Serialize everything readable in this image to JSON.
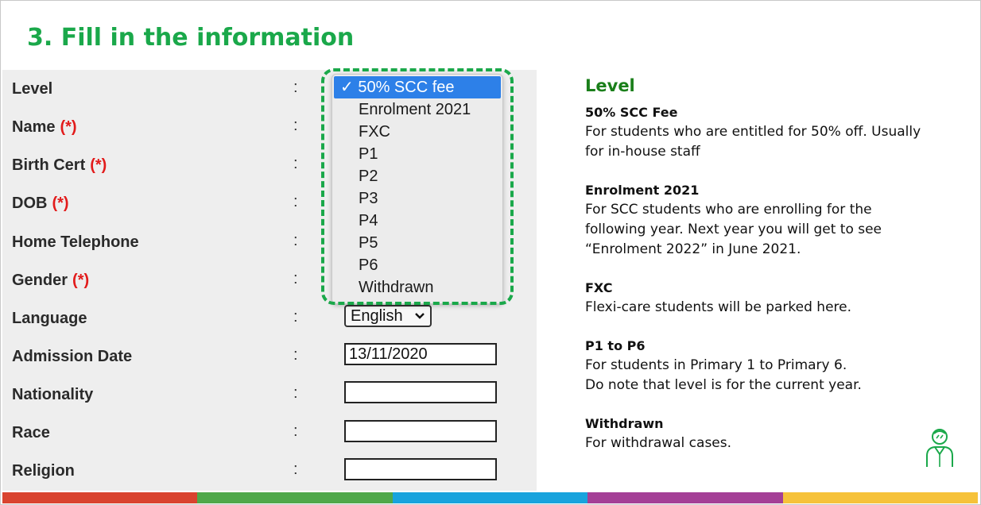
{
  "slide": {
    "title": "3. Fill in the information"
  },
  "form": {
    "colon": ":",
    "required_mark": "(*)",
    "fields": [
      {
        "label": "Level",
        "required": false
      },
      {
        "label": "Name",
        "required": true
      },
      {
        "label": "Birth Cert",
        "required": true
      },
      {
        "label": "DOB",
        "required": true
      },
      {
        "label": "Home Telephone",
        "required": false
      },
      {
        "label": "Gender",
        "required": true
      },
      {
        "label": "Language",
        "required": false
      },
      {
        "label": "Admission Date",
        "required": false
      },
      {
        "label": "Nationality",
        "required": false
      },
      {
        "label": "Race",
        "required": false
      },
      {
        "label": "Religion",
        "required": false
      }
    ],
    "language_value": "English",
    "admission_date_value": "13/11/2020",
    "nationality_value": "",
    "race_value": "",
    "religion_value": ""
  },
  "level_dropdown": {
    "checkmark": "✓",
    "selected": "50% SCC fee",
    "options": [
      "50% SCC fee",
      "Enrolment 2021",
      "FXC",
      "P1",
      "P2",
      "P3",
      "P4",
      "P5",
      "P6",
      "Withdrawn"
    ]
  },
  "notes": {
    "title": "Level",
    "items": [
      {
        "head": "50% SCC Fee",
        "lines": [
          "For students who are entitled for 50% off. Usually",
          "for in-house staff"
        ]
      },
      {
        "head": "Enrolment 2021",
        "lines": [
          "For SCC students who are enrolling for the",
          "following year. Next year you will get to see",
          "“Enrolment 2022” in June 2021."
        ]
      },
      {
        "head": "FXC",
        "lines": [
          "Flexi-care students will be parked here."
        ]
      },
      {
        "head": "P1 to P6",
        "lines": [
          "For students in Primary 1 to Primary 6.",
          "Do note that level is for the current year."
        ]
      },
      {
        "head": "Withdrawn",
        "lines": [
          "For withdrawal cases."
        ]
      }
    ]
  },
  "colors": {
    "title_green": "#1aa84a",
    "required_red": "#e21b1b",
    "selected_blue": "#2d80e8",
    "bar": [
      "#d9432f",
      "#4fa84a",
      "#18a3dd",
      "#a43f96",
      "#f6c23a"
    ]
  },
  "icons": {
    "presenter": "person-icon",
    "dropdown": "chevron-down-icon"
  }
}
